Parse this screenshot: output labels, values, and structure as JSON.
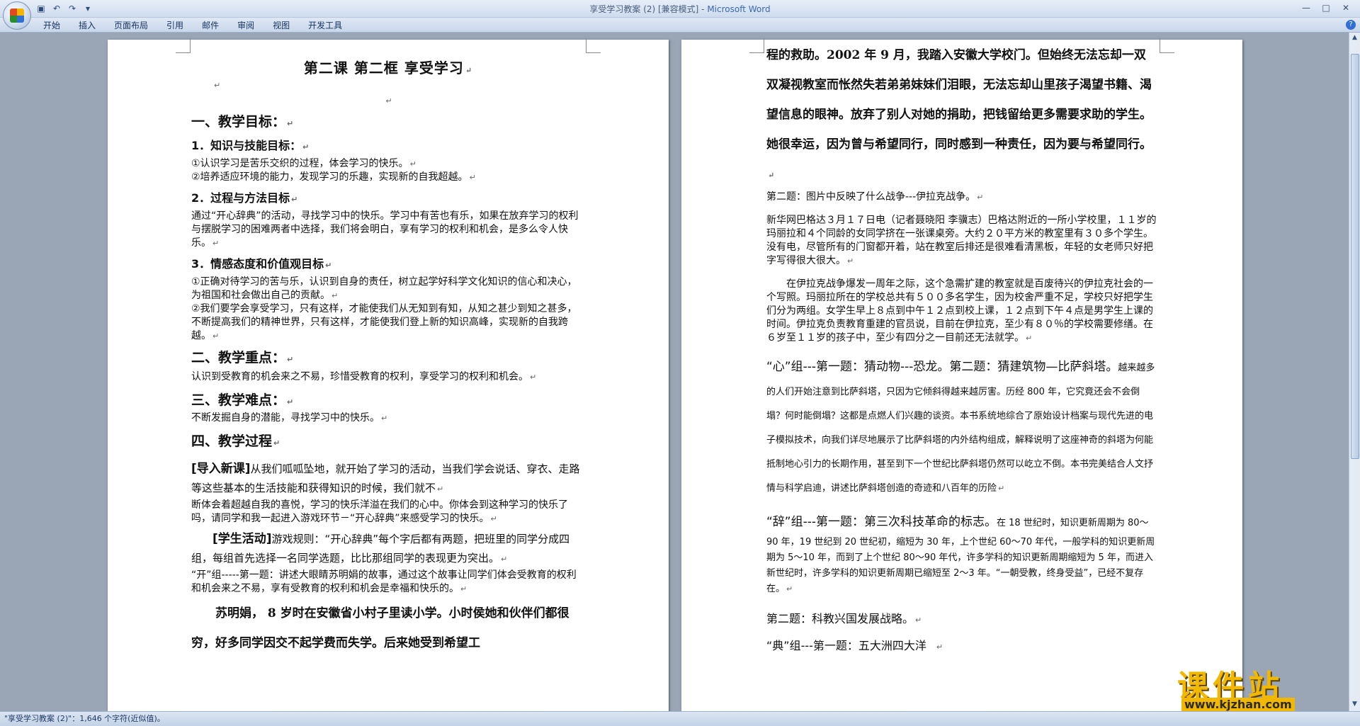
{
  "window": {
    "title": "享受学习教案 (2) [兼容模式] - ",
    "app_name": "Microsoft Word",
    "controls": [
      "—",
      "□",
      "✕"
    ]
  },
  "quick_access": [
    "save-icon",
    "undo-icon",
    "redo-icon",
    "customize-icon"
  ],
  "ribbon": {
    "tabs": [
      "开始",
      "插入",
      "页面布局",
      "引用",
      "邮件",
      "审阅",
      "视图",
      "开发工具"
    ]
  },
  "page1": {
    "title": "第二课  第二框    享受学习",
    "sections": [
      {
        "type": "h1",
        "text": "一、教学目标："
      },
      {
        "type": "h2",
        "text": "1．知识与技能目标："
      },
      {
        "type": "body",
        "text": "①认识学习是苦乐交织的过程，体会学习的快乐。"
      },
      {
        "type": "body",
        "text": "②培养适应环境的能力，发现学习的乐趣，实现新的自我超越。"
      },
      {
        "type": "h2",
        "text": "2．过程与方法目标"
      },
      {
        "type": "body",
        "text": "通过“开心辞典”的活动，寻找学习中的快乐。学习中有苦也有乐，如果在放弃学习的权利与摆脱学习的困难两者中选择，我们将会明白，享有学习的权利和机会，是多么令人快乐。"
      },
      {
        "type": "h2",
        "text": "3．情感态度和价值观目标"
      },
      {
        "type": "body",
        "text": "①正确对待学习的苦与乐，认识到自身的责任，树立起学好科学文化知识的信心和决心，为祖国和社会做出自己的贡献。"
      },
      {
        "type": "body",
        "text": "②我们要学会享受学习，只有这样，才能使我们从无知到有知，从知之甚少到知之甚多，不断提高我们的精神世界，只有这样，才能使我们登上新的知识高峰，实现新的自我跨越。"
      },
      {
        "type": "h1",
        "text": "二、教学重点："
      },
      {
        "type": "body",
        "text": "认识到受教育的机会来之不易，珍惜受教育的权利，享受学习的权利和机会。"
      },
      {
        "type": "h1",
        "text": "三、教学难点："
      },
      {
        "type": "body",
        "text": "不断发掘自身的潜能，寻找学习中的快乐。"
      },
      {
        "type": "h1",
        "text": "四、教学过程"
      }
    ],
    "intro_label": "[导入新课]",
    "intro_text": "从我们呱呱坠地，就开始了学习的活动，当我们学会说话、穿衣、走路等这些基本的生活技能和获得知识的时候，我们就不",
    "intro_text2": "断体会着超越自我的喜悦，学习的快乐洋溢在我们的心中。你体会到这种学习的快乐了吗，请同学和我一起进入游戏环节－“开心辞典”来感受学习的快乐。",
    "activity_label": "[学生活动]",
    "activity_text": "游戏规则：“开心辞典”每个字后都有两题，把班里的同学分成四组，每组首先选择一名同学选题，比比那组同学的表现更为突出。",
    "kai_text": "“开”组-----第一题：讲述大眼睛苏明娟的故事，通过这个故事让同学们体会受教育的权利和机会来之不易，享有受教育的权利和机会是幸福和快乐的。",
    "story_text": "苏明娟， 8 岁时在安徽省小村子里读小学。小时侯她和伙伴们都很穷，好多同学因交不起学费而失学。后来她受到希望工"
  },
  "page2": {
    "story_cont": "程的救助。2002 年 9 月，我踏入安徽大学校门。但始终无法忘却一双双凝视教室而怅然失若弟弟妹妹们泪眼，无法忘却山里孩子渴望书籍、渴望信息的眼神。放弃了别人对她的捐助，把钱留给更多需要求助的学生。她很幸运，因为曾与希望同行，同时感到一种责任，因为要与希望同行。",
    "q2": "第二题：图片中反映了什么战争---伊拉克战争。",
    "news1": "新华网巴格达３月１７日电（记者聂晓阳 李骥志）巴格达附近的一所小学校里，１１岁的玛丽拉和４个同龄的女同学挤在一张课桌旁。大约２０平方米的教室里有３０多个学生。没有电，尽管所有的门窗都开着，站在教室后排还是很难看清黑板，年轻的女老师只好把字写得很大很大。",
    "news2": "在伊拉克战争爆发一周年之际，这个急需扩建的教室就是百废待兴的伊拉克社会的一个写照。玛丽拉所在的学校总共有５００多名学生，因为校舍严重不足，学校只好把学生们分为两组。女学生早上８点到中午１２点到校上课，１２点到下午４点是男学生上课的时间。伊拉克负责教育重建的官员说，目前在伊拉克，至少有８０％的学校需要修缮。在６岁至１１岁的孩子中，至少有四分之一目前还无法就学。",
    "xin_lead": "“心”组---第一题：猜动物---恐龙。第二题：猜建筑物—比萨斜塔。",
    "xin_text": "越来越多的人们开始注意到比萨斜塔，只因为它倾斜得越来越厉害。历经 800 年，它究竟还会不会倒塌？何时能倒塌？这都是点燃人们兴趣的谈资。本书系统地综合了原始设计档案与现代先进的电子模拟技术，向我们详尽地展示了比萨斜塔的内外结构组成，解释说明了这座神奇的斜塔为何能抵制地心引力的长期作用，甚至到下一个世纪比萨斜塔仍然可以屹立不倒。本书完美结合人文抒情与科学启迪，讲述比萨斜塔创造的奇迹和八百年的历险",
    "ci_lead": "“辞”组---第一题：第三次科技革命的标志。",
    "ci_text": "在 18 世纪时，知识更新周期为 80～90 年，19 世纪到 20 世纪初，缩短为 30 年，上个世纪 60～70 年代，一般学科的知识更新周期为 5～10 年，而到了上个世纪 80～90 年代，许多学科的知识更新周期缩短为 5 年，而进入新世纪时，许多学科的知识更新周期已缩短至 2～3 年。“一朝受教，终身受益”，已经不复存在。",
    "ci_q2": "第二题：科教兴国发展战略。",
    "dian": "“典”组---第一题：五大洲四大洋"
  },
  "status": {
    "text": "\"享受学习教案 (2)\"：1,646 个字符(近似值)。"
  },
  "watermark": {
    "text": "课件站",
    "url": "www.kjzhan.com"
  }
}
